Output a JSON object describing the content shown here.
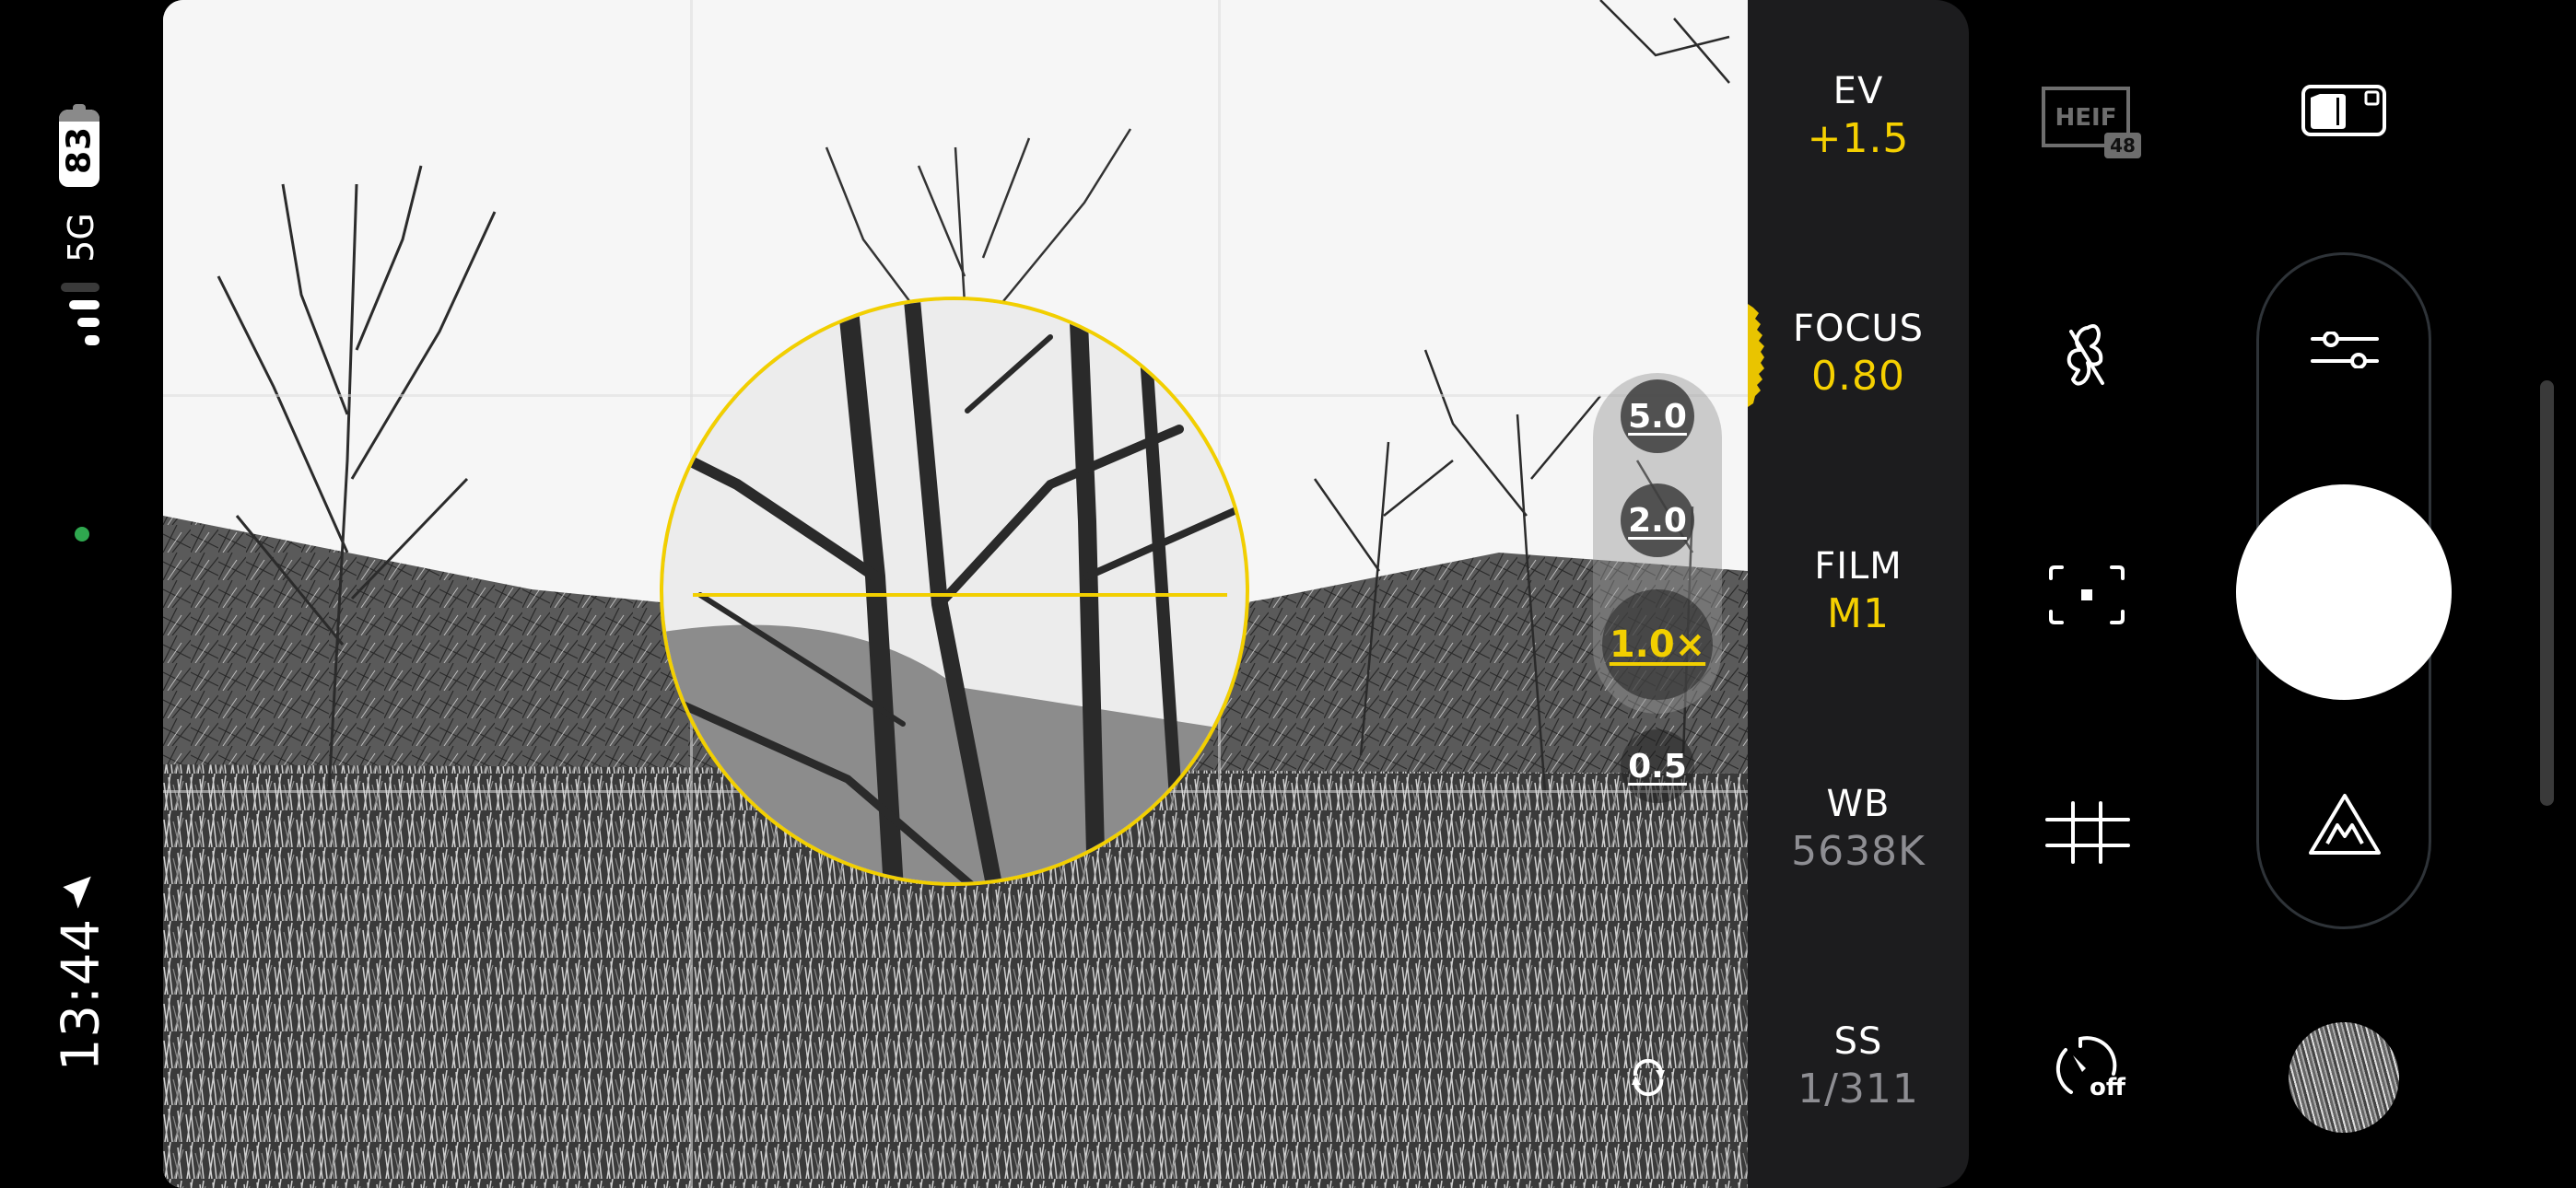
{
  "status_bar": {
    "battery_percent": "83",
    "network": "5G",
    "signal_bars_active": 3,
    "signal_bars_total": 4,
    "time": "13:44",
    "icons": {
      "battery": "battery-icon",
      "signal": "signal-bars-icon",
      "privacy_indicator": "camera-in-use-dot",
      "location": "location-arrow-icon"
    },
    "privacy_indicator_color": "#2fa84f"
  },
  "viewfinder": {
    "grid": "rule-of-thirds",
    "focus_loupe": {
      "visible": true,
      "color": "#f2cf00"
    },
    "zoom_levels": [
      {
        "label": "5.0",
        "active": false
      },
      {
        "label": "2.0",
        "active": false
      },
      {
        "label": "1.0×",
        "active": true
      },
      {
        "label": "0.5",
        "active": false
      }
    ],
    "switch_camera_icon": "rotate-camera-icon"
  },
  "parameters": [
    {
      "label": "EV",
      "value": "+1.5",
      "state": "manual"
    },
    {
      "label": "FOCUS",
      "value": "0.80",
      "state": "manual"
    },
    {
      "label": "FILM",
      "value": "M1",
      "state": "manual"
    },
    {
      "label": "WB",
      "value": "5638K",
      "state": "auto"
    },
    {
      "label": "SS",
      "value": "1/311",
      "state": "auto"
    }
  ],
  "controls": {
    "format_badge": {
      "label": "HEIF",
      "sub": "48",
      "icon": "heif-format-icon"
    },
    "storage_icon": "sd-card-storage-icon",
    "flash_icon": "flash-off-icon",
    "focus_mode_icon": "focus-area-icon",
    "grid_icon": "grid-icon",
    "timer": {
      "label": "off",
      "icon": "timer-icon"
    },
    "settings_icon": "sliders-icon",
    "shutter": "shutter-button",
    "mode_icon": "manual-mountain-mode-icon",
    "thumbnail": "last-photo-thumbnail"
  },
  "colors": {
    "accent": "#f5d000",
    "panel": "#1c1c1e",
    "muted": "#8e8e93"
  }
}
